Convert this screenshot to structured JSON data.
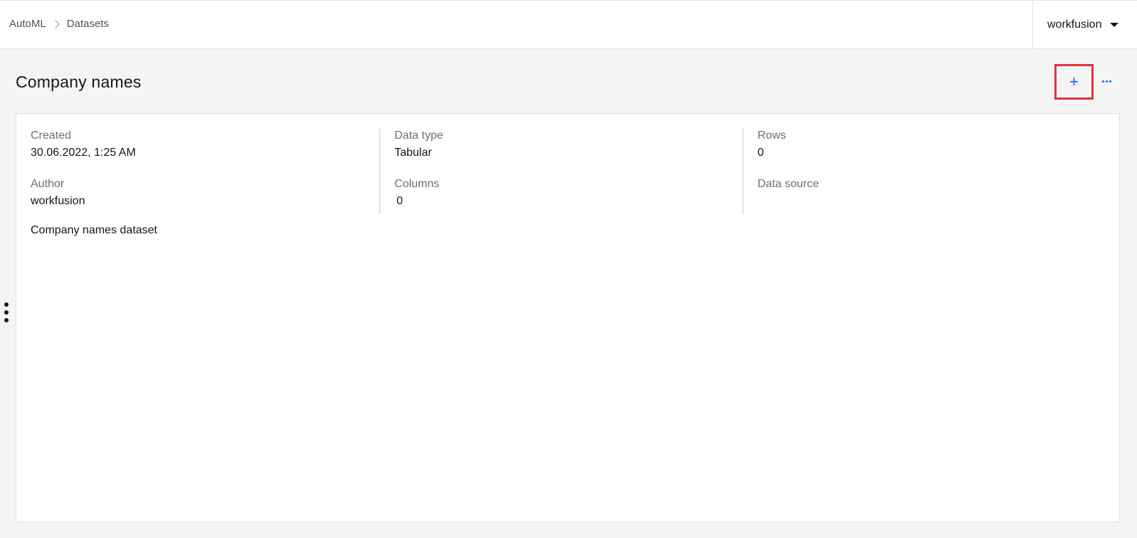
{
  "breadcrumb": {
    "items": [
      "AutoML",
      "Datasets"
    ]
  },
  "user_menu": {
    "username": "workfusion"
  },
  "page": {
    "title": "Company names",
    "add_button_label": "+",
    "more_icon": "overflow-menu-icon"
  },
  "details": {
    "created_label": "Created",
    "created_value": "30.06.2022, 1:25 AM",
    "author_label": "Author",
    "author_value": "workfusion",
    "data_type_label": "Data type",
    "data_type_value": "Tabular",
    "columns_label": "Columns",
    "columns_value": "0",
    "rows_label": "Rows",
    "rows_value": "0",
    "data_source_label": "Data source",
    "data_source_value": "",
    "description": "Company names dataset"
  },
  "colors": {
    "accent": "#0f62fe",
    "highlight": "#e5313d"
  }
}
